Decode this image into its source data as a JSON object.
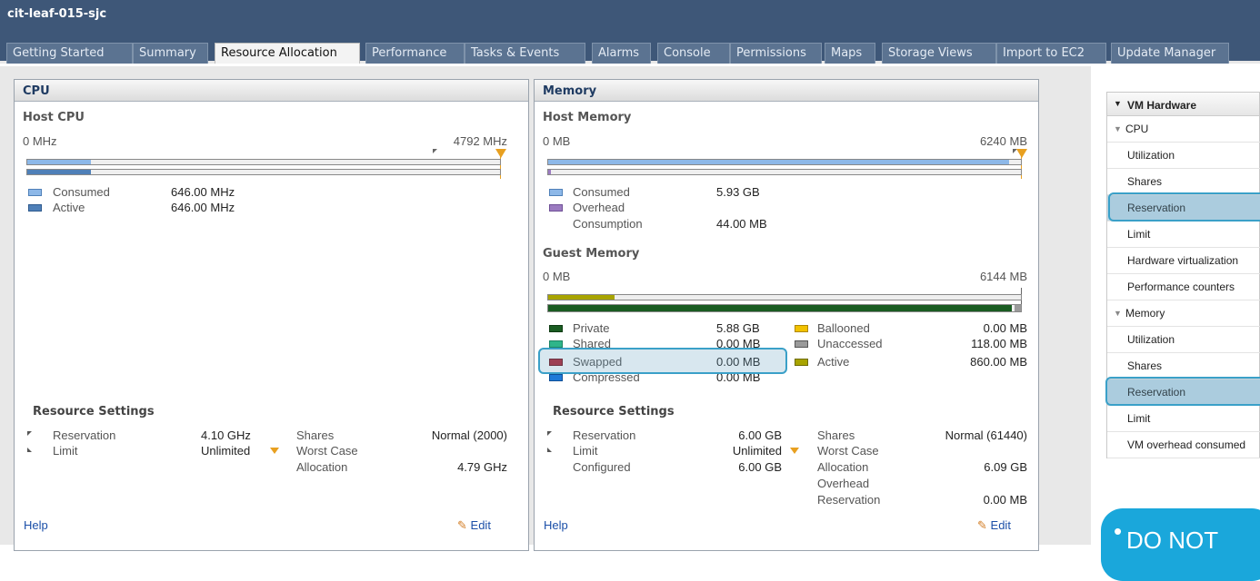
{
  "window_title": "cit-leaf-015-sjc",
  "tabs": [
    "Getting Started",
    "Summary",
    "Resource Allocation",
    "Performance",
    "Tasks & Events",
    "Alarms",
    "Console",
    "Permissions",
    "Maps",
    "Storage Views",
    "Import to EC2",
    "Update Manager"
  ],
  "active_tab": "Resource Allocation",
  "cpu": {
    "title": "CPU",
    "sub": "Host CPU",
    "min": "0 MHz",
    "max": "4792 MHz",
    "consumed_label": "Consumed",
    "consumed_value": "646.00 MHz",
    "active_label": "Active",
    "active_value": "646.00 MHz",
    "usage_fraction": 0.135,
    "settings_title": "Resource Settings",
    "reservation_label": "Reservation",
    "reservation_value": "4.10 GHz",
    "limit_label": "Limit",
    "limit_value": "Unlimited",
    "shares_label": "Shares",
    "shares_value": "Normal (2000)",
    "worst_label_1": "Worst Case",
    "worst_label_2": "Allocation",
    "worst_value": "4.79 GHz",
    "help": "Help",
    "edit": "Edit"
  },
  "memory": {
    "title": "Memory",
    "sub": "Host Memory",
    "min": "0 MB",
    "max": "6240 MB",
    "consumed_label": "Consumed",
    "consumed_value": "5.93 GB",
    "overhead_label_1": "Overhead",
    "overhead_label_2": "Consumption",
    "overhead_value": "44.00 MB",
    "consumed_fraction": 0.975,
    "guest_title": "Guest Memory",
    "guest_min": "0 MB",
    "guest_max": "6144 MB",
    "guest_active_fraction": 0.14,
    "guest_private_fraction": 0.98,
    "private_label": "Private",
    "private_value": "5.88 GB",
    "shared_label": "Shared",
    "shared_value": "0.00 MB",
    "swapped_label": "Swapped",
    "swapped_value": "0.00 MB",
    "compressed_label": "Compressed",
    "compressed_value": "0.00 MB",
    "ballooned_label": "Ballooned",
    "ballooned_value": "0.00 MB",
    "unaccessed_label": "Unaccessed",
    "unaccessed_value": "118.00 MB",
    "active_label": "Active",
    "active_value": "860.00 MB",
    "settings_title": "Resource Settings",
    "reservation_label": "Reservation",
    "reservation_value": "6.00 GB",
    "limit_label": "Limit",
    "limit_value": "Unlimited",
    "configured_label": "Configured",
    "configured_value": "6.00 GB",
    "shares_label": "Shares",
    "shares_value": "Normal (61440)",
    "worst_label_1": "Worst Case",
    "worst_label_2": "Allocation",
    "worst_value": "6.09 GB",
    "ovres_label_1": "Overhead",
    "ovres_label_2": "Reservation",
    "ovres_value": "0.00 MB",
    "help": "Help",
    "edit": "Edit"
  },
  "hardware": {
    "title": "VM Hardware",
    "cpu_group": "CPU",
    "cpu_items": [
      "Utilization",
      "Shares",
      "Reservation",
      "Limit",
      "Hardware virtualization",
      "Performance counters"
    ],
    "mem_group": "Memory",
    "mem_items": [
      "Utilization",
      "Shares",
      "Reservation",
      "Limit",
      "VM overhead consumed"
    ]
  },
  "callout": "DO NOT",
  "colors": {
    "consumed": "#8db8e8",
    "active": "#4f80b8",
    "private": "#1a5c22",
    "shared": "#2fb58a",
    "swapped": "#b02030",
    "compressed": "#1e7ad8",
    "ballooned": "#f2c200",
    "unaccessed": "#9a9a9a",
    "guest_active": "#a8a400",
    "overhead": "#9b7bc0",
    "marker": "#e8a020"
  }
}
